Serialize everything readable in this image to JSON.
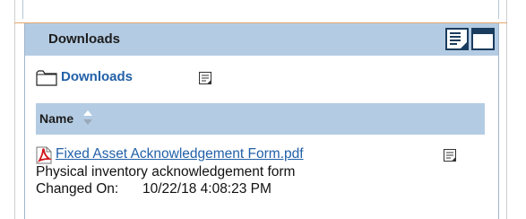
{
  "panel": {
    "title": "Downloads"
  },
  "folder": {
    "name": "Downloads"
  },
  "table": {
    "column_header": "Name"
  },
  "files": [
    {
      "name": "Fixed Asset Acknowledgement Form.pdf",
      "description": "Physical inventory acknowledgement form",
      "changed_label": "Changed On:",
      "changed_value": "10/22/18 4:08:23 PM"
    }
  ],
  "colors": {
    "header_bg": "#b4cce3",
    "link": "#2260a8",
    "pdf_red": "#d0141a"
  }
}
